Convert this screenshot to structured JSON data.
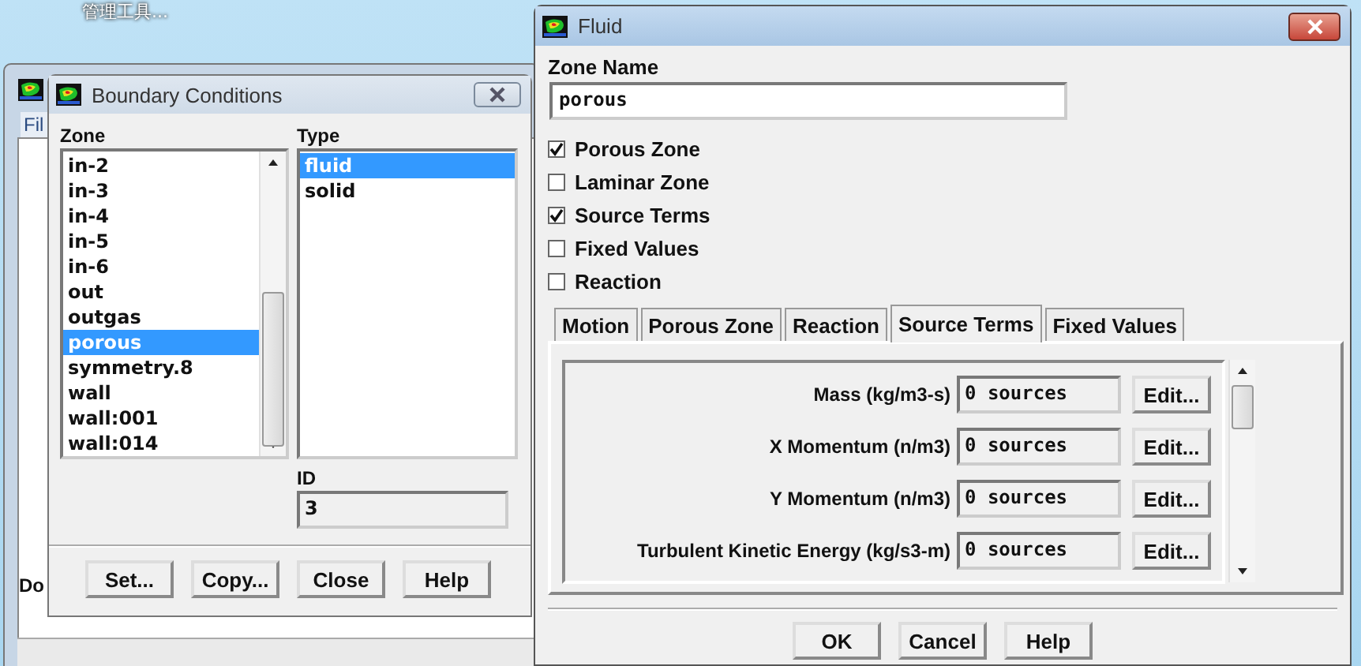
{
  "desktop": {
    "label": "管理工具..."
  },
  "background_window": {
    "menu": "Fil",
    "label": "Do"
  },
  "boundary_conditions": {
    "title": "Boundary Conditions",
    "zone_label": "Zone",
    "zones": [
      {
        "label": "in-2",
        "selected": false
      },
      {
        "label": "in-3",
        "selected": false
      },
      {
        "label": "in-4",
        "selected": false
      },
      {
        "label": "in-5",
        "selected": false
      },
      {
        "label": "in-6",
        "selected": false
      },
      {
        "label": "out",
        "selected": false
      },
      {
        "label": "outgas",
        "selected": false
      },
      {
        "label": "porous",
        "selected": true
      },
      {
        "label": "symmetry.8",
        "selected": false
      },
      {
        "label": "wall",
        "selected": false
      },
      {
        "label": "wall:001",
        "selected": false
      },
      {
        "label": "wall:014",
        "selected": false
      }
    ],
    "type_label": "Type",
    "types": [
      {
        "label": "fluid",
        "selected": true
      },
      {
        "label": "solid",
        "selected": false
      }
    ],
    "id_label": "ID",
    "id_value": "3",
    "buttons": [
      "Set...",
      "Copy...",
      "Close",
      "Help"
    ]
  },
  "fluid": {
    "title": "Fluid",
    "zone_name_label": "Zone Name",
    "zone_name": "porous",
    "options": [
      {
        "label": "Porous Zone",
        "checked": true
      },
      {
        "label": "Laminar Zone",
        "checked": false
      },
      {
        "label": "Source Terms",
        "checked": true
      },
      {
        "label": "Fixed Values",
        "checked": false
      },
      {
        "label": "Reaction",
        "checked": false
      }
    ],
    "tabs": [
      {
        "label": "Motion",
        "selected": false
      },
      {
        "label": "Porous Zone",
        "selected": false
      },
      {
        "label": "Reaction",
        "selected": false
      },
      {
        "label": "Source Terms",
        "selected": true
      },
      {
        "label": "Fixed Values",
        "selected": false
      }
    ],
    "source_terms": [
      {
        "label": "Mass (kg/m3-s)",
        "value": "0 sources",
        "button": "Edit..."
      },
      {
        "label": "X Momentum (n/m3)",
        "value": "0 sources",
        "button": "Edit..."
      },
      {
        "label": "Y Momentum (n/m3)",
        "value": "0 sources",
        "button": "Edit..."
      },
      {
        "label": "Turbulent Kinetic Energy (kg/s3-m)",
        "value": "0 sources",
        "button": "Edit..."
      }
    ],
    "buttons": [
      "OK",
      "Cancel",
      "Help"
    ]
  }
}
